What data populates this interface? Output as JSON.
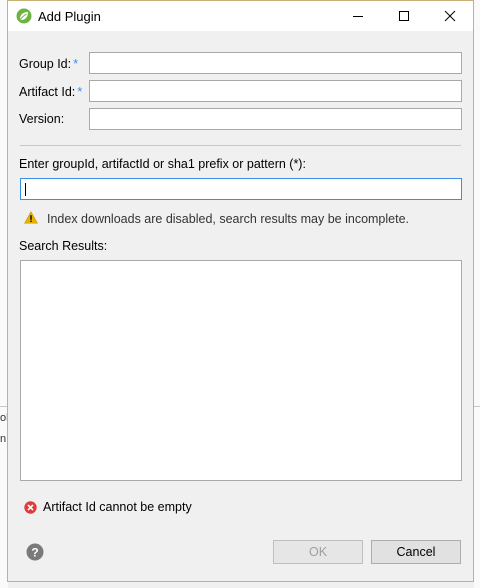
{
  "dialog": {
    "title": "Add Plugin",
    "window_controls": [
      "minimize",
      "maximize",
      "close"
    ]
  },
  "form": {
    "group_id": {
      "label": "Group Id:",
      "required_mark": "*",
      "value": ""
    },
    "artifact_id": {
      "label": "Artifact Id:",
      "required_mark": "*",
      "value": ""
    },
    "version": {
      "label": "Version:",
      "value": ""
    }
  },
  "search": {
    "label": "Enter groupId, artifactId or sha1 prefix or pattern (*):",
    "value": "",
    "warning": "Index downloads are disabled, search results may be incomplete.",
    "results_label": "Search Results:",
    "results": []
  },
  "status": {
    "error": "Artifact Id cannot be empty"
  },
  "buttons": {
    "ok": "OK",
    "cancel": "Cancel"
  },
  "background": {
    "left_fragments": [
      "ol",
      "n"
    ]
  },
  "colors": {
    "required_asterisk": "#3b8ee6",
    "title_icon": "#6db33f",
    "warning": "#e8b400",
    "error": "#e23a3a",
    "help": "#7a7a7a"
  }
}
